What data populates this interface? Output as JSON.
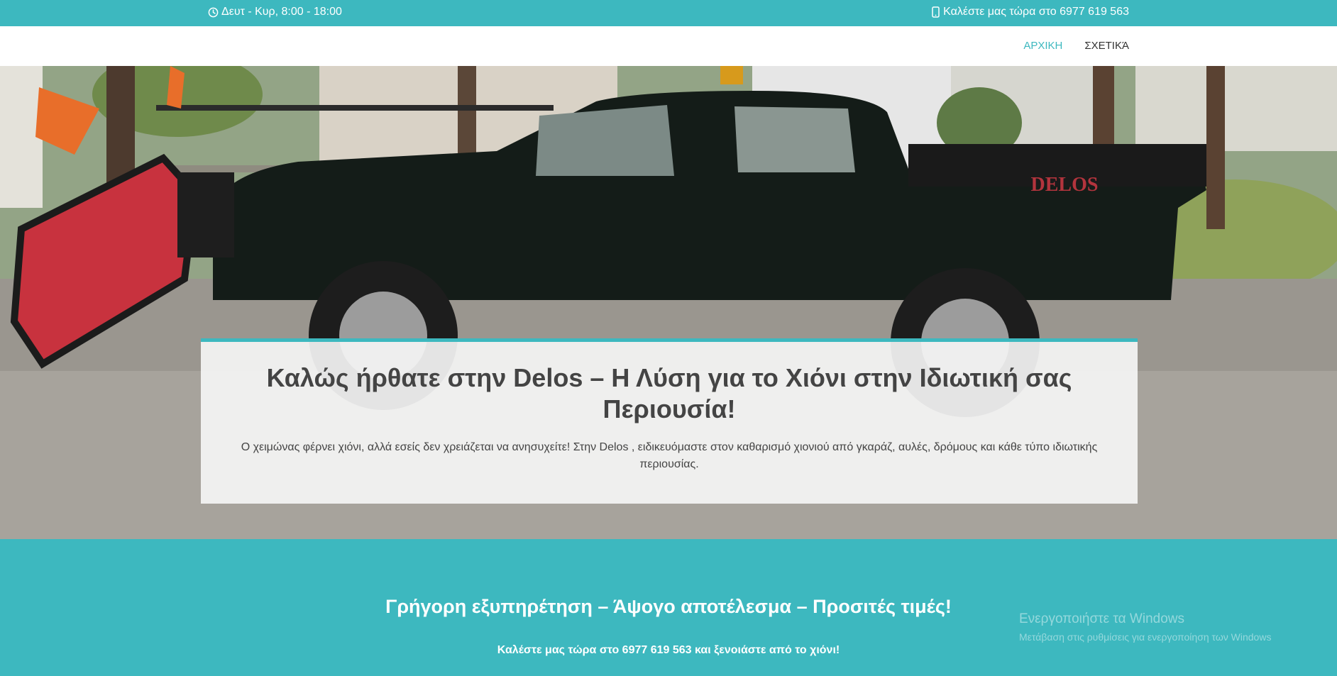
{
  "topbar": {
    "hours": "Δευτ - Κυρ, 8:00 - 18:00",
    "phone": "Καλέστε μας τώρα στο 6977 619 563",
    "hours_icon": "clock-icon",
    "phone_icon": "mobile-phone-icon"
  },
  "nav": {
    "items": [
      {
        "label": "ΑΡΧΙΚΗ",
        "active": true
      },
      {
        "label": "ΣΧΕΤΙΚΆ",
        "active": false
      }
    ]
  },
  "hero": {
    "truck_badge": "DELOS",
    "title": "Καλώς ήρθατε στην Delos – Η Λύση για το Χιόνι στην Ιδιωτική σας Περιουσία!",
    "text": "Ο χειμώνας φέρνει χιόνι, αλλά εσείς δεν χρειάζεται να ανησυχείτε! Στην Delos , ειδικευόμαστε στον καθαρισμό χιονιού από γκαράζ, αυλές, δρόμους και κάθε τύπο ιδιωτικής περιουσίας."
  },
  "cta": {
    "heading": "Γρήγορη εξυπηρέτηση – Άψογο αποτέλεσμα – Προσιτές τιμές!",
    "text": "Καλέστε μας τώρα στο 6977 619 563 και ξενοιάστε από το χιόνι!"
  },
  "watermark": {
    "line1": "Ενεργοποιήστε τα Windows",
    "line2": "Μετάβαση στις ρυθμίσεις για ενεργοποίηση των Windows"
  },
  "colors": {
    "accent": "#3db8bf",
    "text_dark": "#444444",
    "truck": "#141c18",
    "plow": "#c8323e"
  }
}
